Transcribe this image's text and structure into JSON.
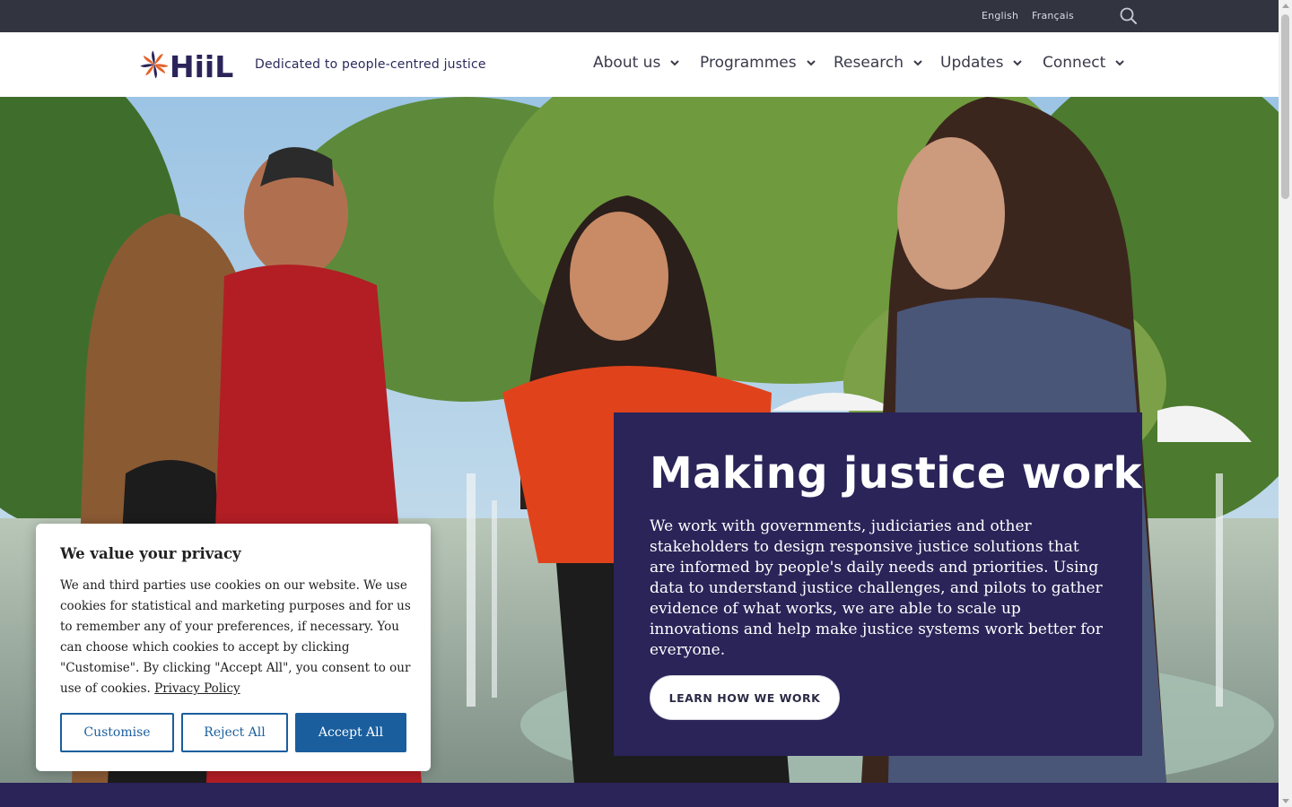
{
  "topbar": {
    "languages": [
      "English",
      "Français"
    ]
  },
  "header": {
    "logo_text": "HiiL",
    "tagline": "Dedicated to people-centred justice",
    "nav": [
      {
        "label": "About us"
      },
      {
        "label": "Programmes"
      },
      {
        "label": "Research"
      },
      {
        "label": "Updates"
      },
      {
        "label": "Connect"
      }
    ]
  },
  "hero": {
    "title": "Making justice work",
    "body": "We work with governments, judiciaries and other stakeholders to design responsive justice solutions that are informed by people's daily needs and priorities. Using data to understand justice challenges, and pilots to gather evidence of what works, we are able to scale up innovations and help make justice systems work better for everyone.",
    "cta": "LEARN HOW WE WORK"
  },
  "cookie": {
    "title": "We value your privacy",
    "body": "We and third parties use cookies on our website. We use cookies for statistical and marketing purposes and for us to remember any of your preferences, if necessary. You can choose which cookies to accept by clicking \"Customise\". By clicking \"Accept All\", you consent to our use of cookies.",
    "privacy_link": "Privacy Policy",
    "buttons": {
      "customise": "Customise",
      "reject": "Reject All",
      "accept": "Accept All"
    }
  },
  "colors": {
    "topbar": "#32343f",
    "brand_navy": "#2a2459",
    "cookie_blue": "#1a5e9e",
    "logo_orange": "#e2632b"
  },
  "icons": {
    "search": "search-icon",
    "nav_caret": "chevron-down-icon",
    "logo_mark": "pinwheel-logo-icon"
  }
}
